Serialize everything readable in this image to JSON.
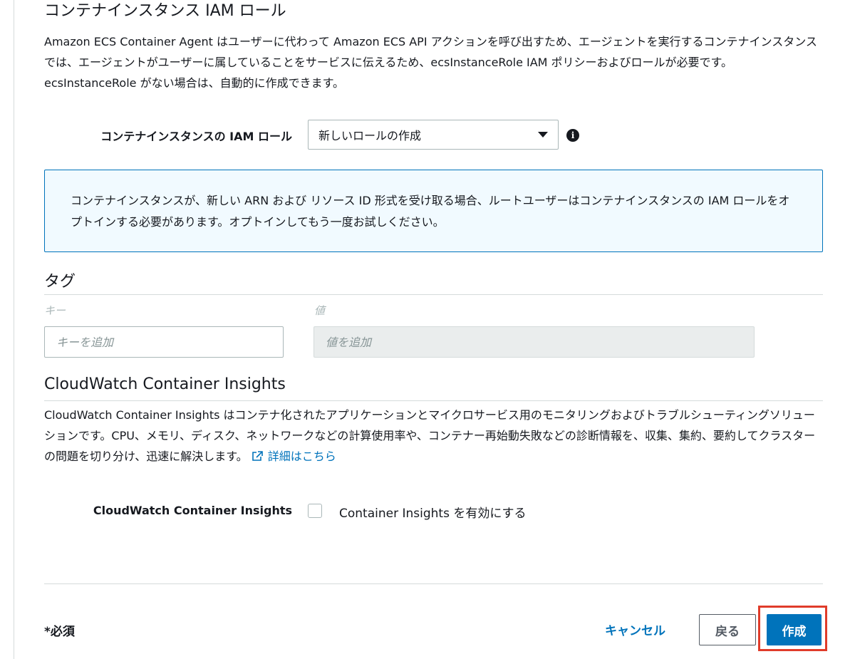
{
  "iam_section": {
    "heading": "コンテナインスタンス IAM ロール",
    "description": "Amazon ECS Container Agent はユーザーに代わって Amazon ECS API アクションを呼び出すため、エージェントを実行するコンテナインスタンスでは、エージェントがユーザーに属していることをサービスに伝えるため、ecsInstanceRole IAM ポリシーおよびロールが必要です。ecsInstanceRole がない場合は、自動的に作成できます。",
    "field_label": "コンテナインスタンスの IAM ロール",
    "select_value": "新しいロールの作成",
    "info_icon": "info-icon"
  },
  "alert": {
    "text": "コンテナインスタンスが、新しい ARN および リソース ID 形式を受け取る場合、ルートユーザーはコンテナインスタンスの IAM ロールをオプトインする必要があります。オプトインしてもう一度お試しください。",
    "border_color": "#0073bb",
    "background": "#f1faff"
  },
  "tags": {
    "heading": "タグ",
    "key_column": "キー",
    "value_column": "値",
    "key_placeholder": "キーを追加",
    "value_placeholder": "値を追加"
  },
  "insights": {
    "heading": "CloudWatch Container Insights",
    "description": "CloudWatch Container Insights はコンテナ化されたアプリケーションとマイクロサービス用のモニタリングおよびトラブルシューティングソリューションです。CPU、メモリ、ディスク、ネットワークなどの計算使用率や、コンテナー再始動失敗などの診断情報を、収集、集約、要約してクラスターの問題を切り分け、迅速に解決します。",
    "link_label": "詳細はこちら",
    "link_icon": "external-link-icon",
    "field_label": "CloudWatch Container Insights",
    "checkbox_label": "Container Insights を有効にする",
    "checkbox_checked": false
  },
  "footer": {
    "required_note": "*必須",
    "cancel_label": "キャンセル",
    "back_label": "戻る",
    "create_label": "作成",
    "primary_color": "#0073bb",
    "highlight_color": "#e03c2a"
  }
}
